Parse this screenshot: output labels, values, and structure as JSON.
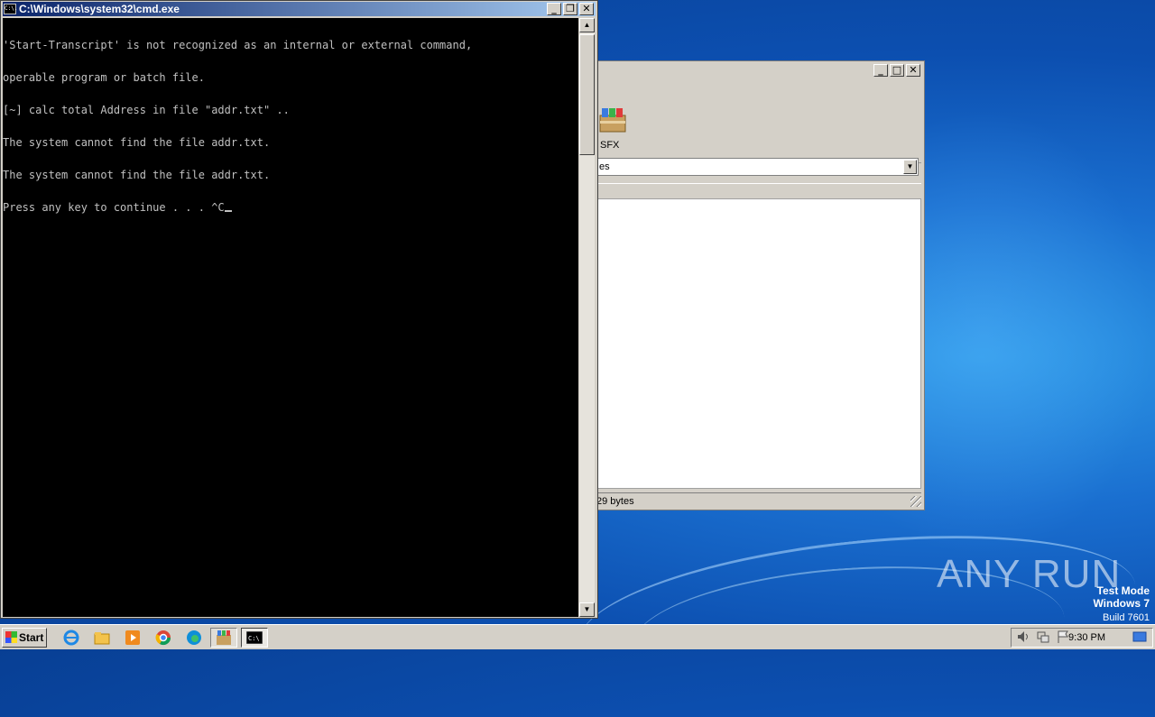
{
  "cmd": {
    "title": "C:\\Windows\\system32\\cmd.exe",
    "icon_text": "C:\\.",
    "lines": [
      "'Start-Transcript' is not recognized as an internal or external command,",
      "operable program or batch file.",
      "[~] calc total Address in file \"addr.txt\" ..",
      "The system cannot find the file addr.txt.",
      "The system cannot find the file addr.txt.",
      "Press any key to continue . . . ^C"
    ],
    "minimize_glyph": "_",
    "restore_glyph": "❐",
    "close_glyph": "✕",
    "scroll_up_glyph": "▲",
    "scroll_down_glyph": "▼"
  },
  "archiver": {
    "sfx_label": "SFX",
    "combo_value": "es",
    "combo_arrow_glyph": "▼",
    "status_text": "29 bytes",
    "minimize_glyph": "_",
    "maximize_glyph": "□",
    "close_glyph": "✕"
  },
  "taskbar": {
    "start_label": "Start",
    "clock": "9:30 PM"
  },
  "watermark": {
    "brand": "ANY RUN",
    "line1": "Test Mode",
    "line2": "Windows 7",
    "line3": "Build 7601"
  },
  "colors": {
    "console_bg": "#000000",
    "console_fg": "#c0c0c0",
    "titlebar_start": "#0a246a",
    "titlebar_end": "#a6caf0",
    "desktop": "#1a6fd0"
  }
}
